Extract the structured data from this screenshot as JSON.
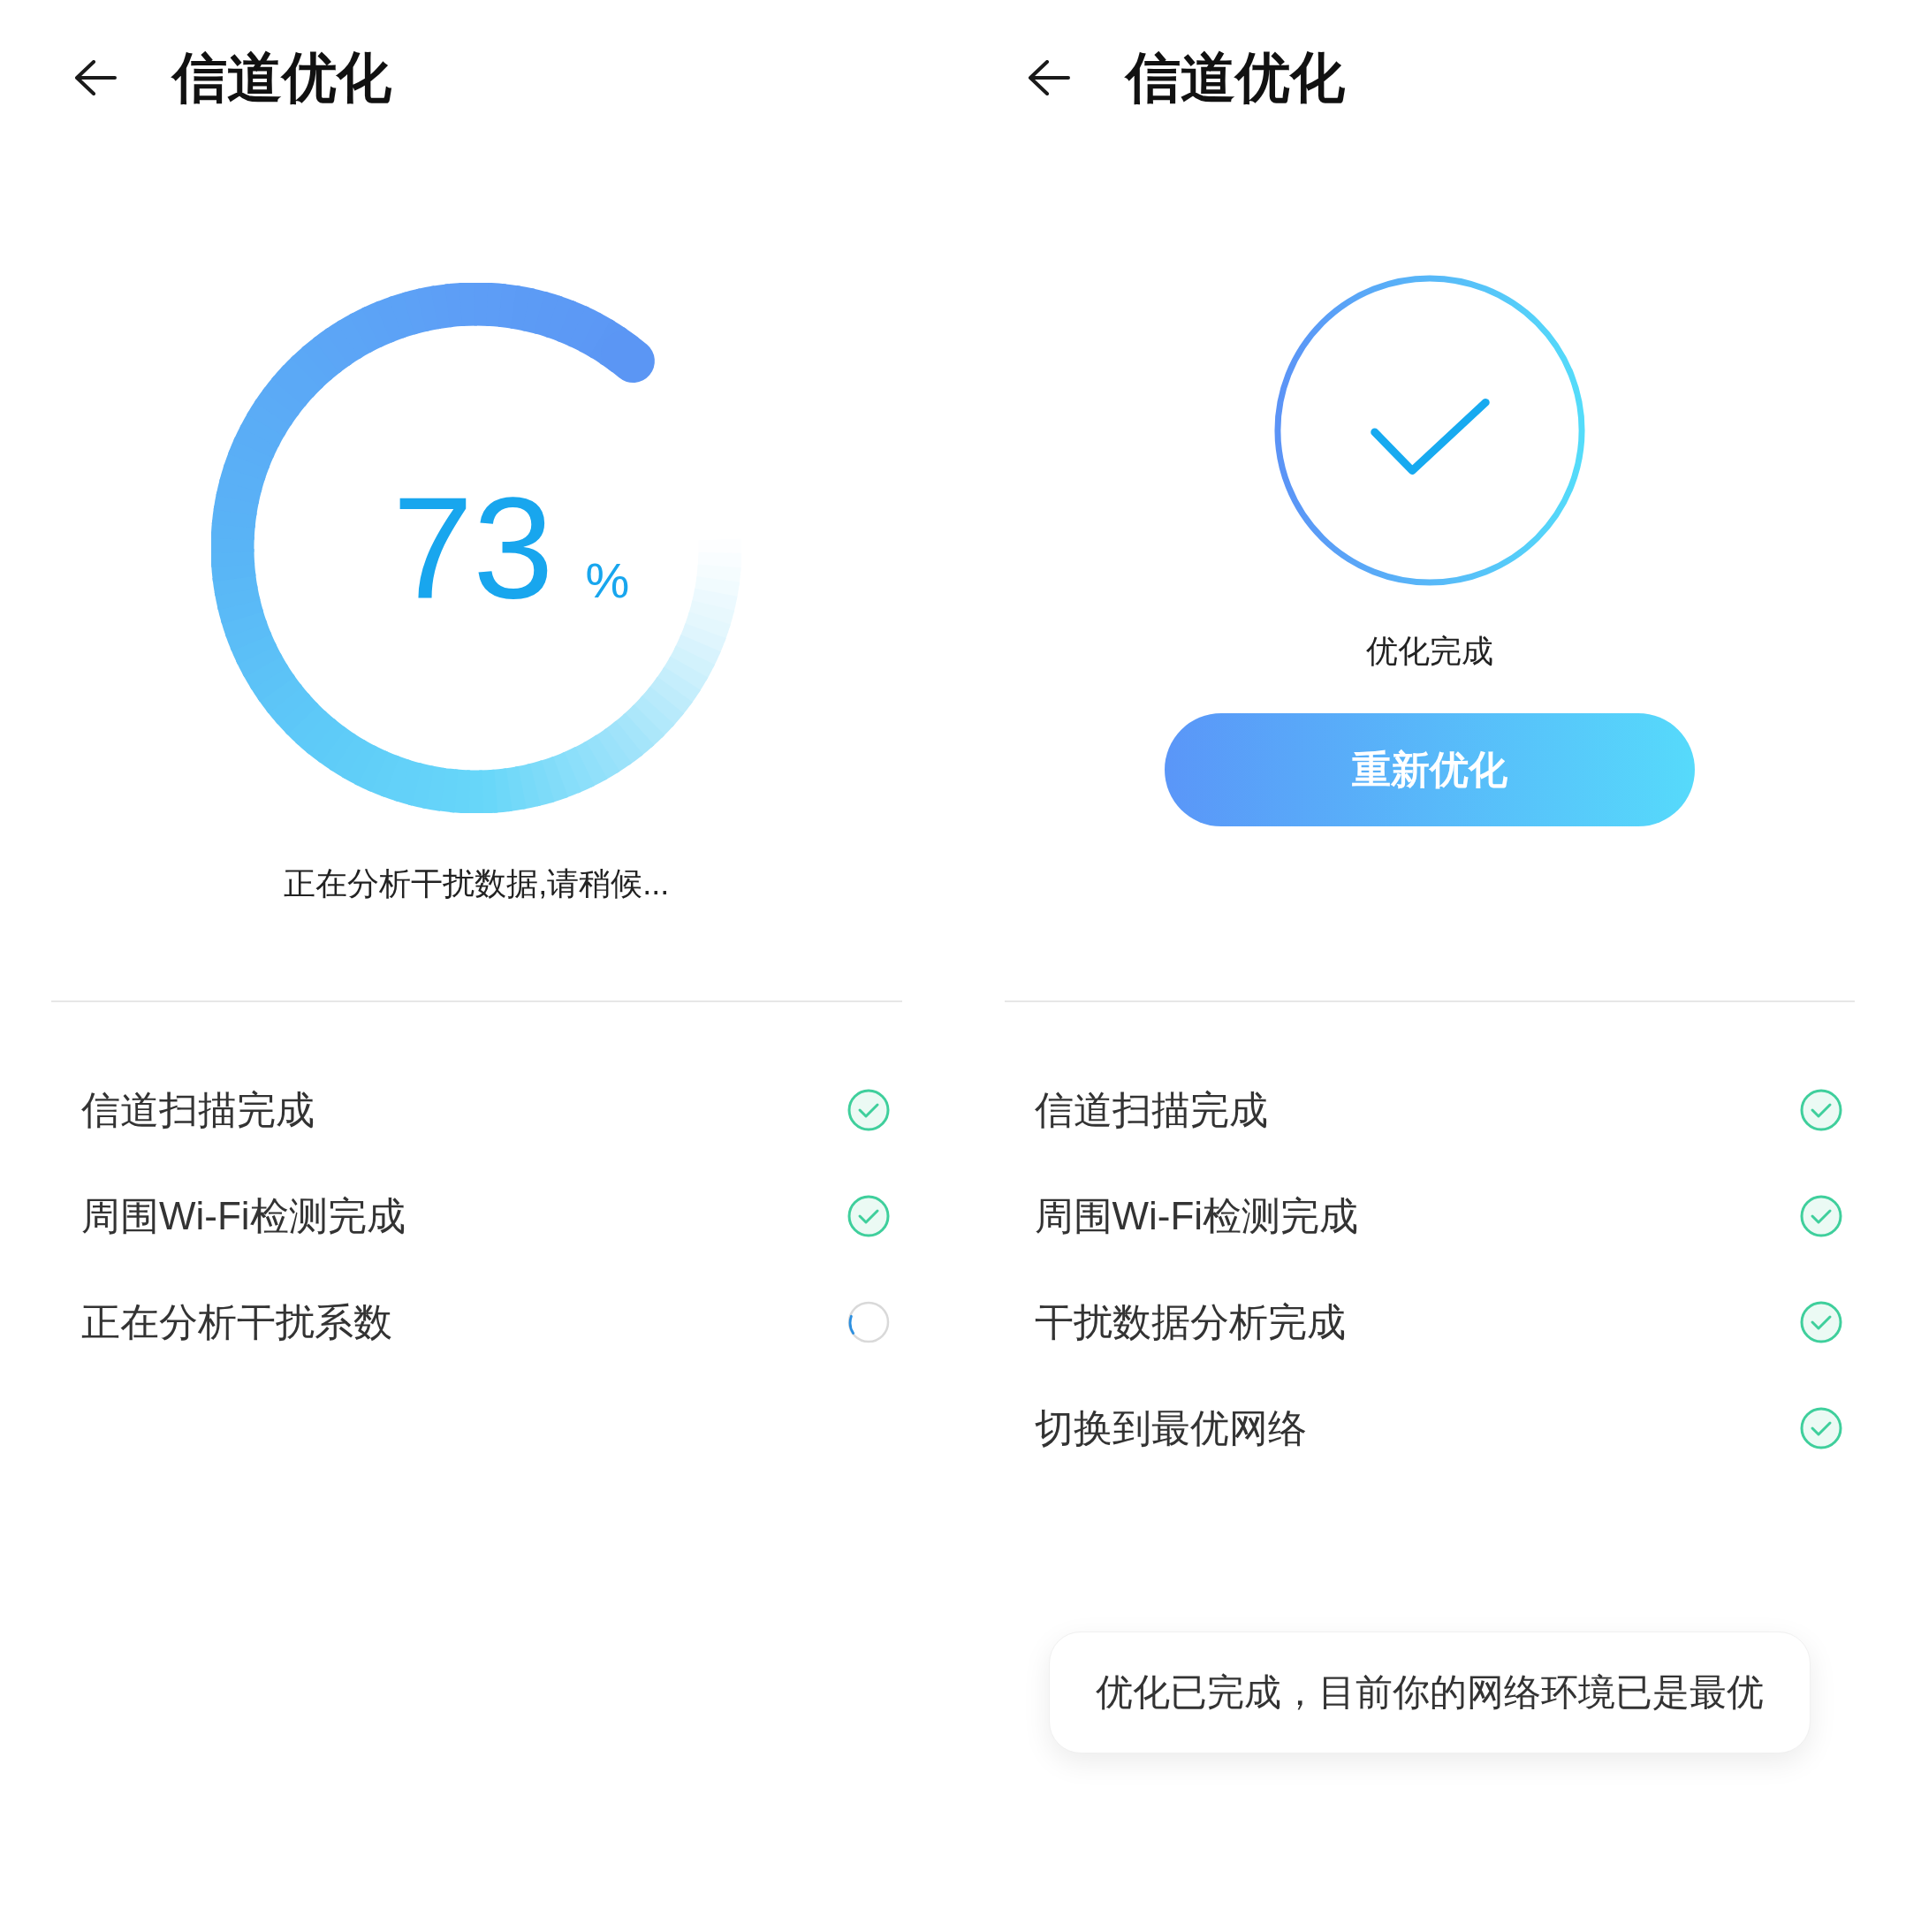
{
  "panels": [
    {
      "kind": "progress",
      "header": {
        "title": "信道优化"
      },
      "progress": {
        "value": "73",
        "unit": "%",
        "message": "正在分析干扰数据,请稍候..."
      },
      "steps": [
        {
          "label": "信道扫描完成",
          "done": true
        },
        {
          "label": "周围Wi-Fi检测完成",
          "done": true
        },
        {
          "label": "正在分析干扰系数",
          "done": false
        }
      ]
    },
    {
      "kind": "result",
      "header": {
        "title": "信道优化"
      },
      "result": {
        "message": "优化完成",
        "button": "重新优化"
      },
      "steps": [
        {
          "label": "信道扫描完成",
          "done": true
        },
        {
          "label": "周围Wi-Fi检测完成",
          "done": true
        },
        {
          "label": "干扰数据分析完成",
          "done": true
        },
        {
          "label": "切换到最优网络",
          "done": true
        }
      ],
      "toast": "优化已完成，目前你的网络环境已是最优"
    }
  ]
}
